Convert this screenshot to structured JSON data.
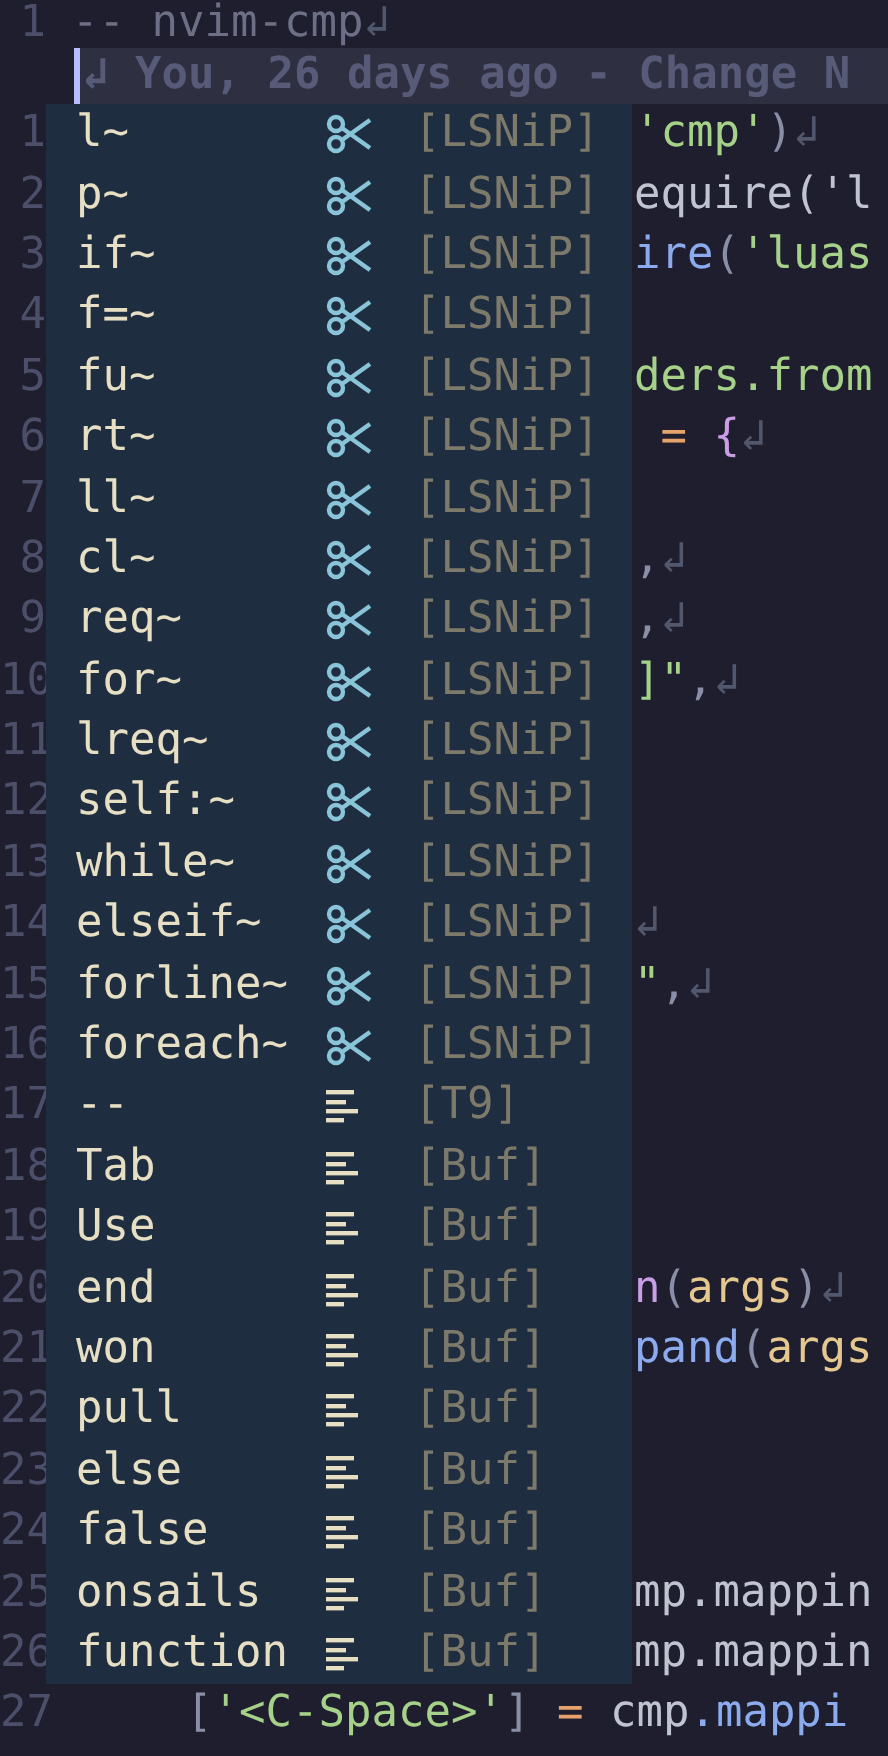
{
  "top_line": {
    "number": "1",
    "code": [
      {
        "text": "-- nvim-cmp",
        "kind": "comment"
      },
      {
        "text": "↲",
        "kind": "eol"
      }
    ]
  },
  "blame": {
    "text": "↲ You, 26 days ago - Change N"
  },
  "rows": [
    {
      "number": "1",
      "item": {
        "label": "l~",
        "kind": "snippet",
        "source": "[LSNiP]"
      },
      "code": [
        {
          "text": "'cmp'",
          "kind": "string"
        },
        {
          "text": ")",
          "kind": "punct"
        },
        {
          "text": "↲",
          "kind": "eol"
        }
      ]
    },
    {
      "number": "2",
      "item": {
        "label": "p~",
        "kind": "snippet",
        "source": "[LSNiP]"
      },
      "code": [
        {
          "text": "equire('l",
          "kind": "plain"
        }
      ]
    },
    {
      "number": "3",
      "item": {
        "label": "if~",
        "kind": "snippet",
        "source": "[LSNiP]"
      },
      "code": [
        {
          "text": "ire",
          "kind": "func"
        },
        {
          "text": "(",
          "kind": "punct"
        },
        {
          "text": "'luas",
          "kind": "string"
        }
      ]
    },
    {
      "number": "4",
      "item": {
        "label": "f=~",
        "kind": "snippet",
        "source": "[LSNiP]"
      },
      "code": []
    },
    {
      "number": "5",
      "item": {
        "label": "fu~",
        "kind": "snippet",
        "source": "[LSNiP]"
      },
      "code": [
        {
          "text": "ders.from",
          "kind": "string"
        }
      ]
    },
    {
      "number": "6",
      "item": {
        "label": "rt~",
        "kind": "snippet",
        "source": "[LSNiP]"
      },
      "code": [
        {
          "text": " = ",
          "kind": "op"
        },
        {
          "text": "{",
          "kind": "brace"
        },
        {
          "text": "↲",
          "kind": "eol"
        }
      ]
    },
    {
      "number": "7",
      "item": {
        "label": "ll~",
        "kind": "snippet",
        "source": "[LSNiP]"
      },
      "code": []
    },
    {
      "number": "8",
      "item": {
        "label": "cl~",
        "kind": "snippet",
        "source": "[LSNiP]"
      },
      "code": [
        {
          "text": ",",
          "kind": "punct"
        },
        {
          "text": "↲",
          "kind": "eol"
        }
      ]
    },
    {
      "number": "9",
      "item": {
        "label": "req~",
        "kind": "snippet",
        "source": "[LSNiP]"
      },
      "code": [
        {
          "text": ",",
          "kind": "punct"
        },
        {
          "text": "↲",
          "kind": "eol"
        }
      ]
    },
    {
      "number": "10",
      "item": {
        "label": "for~",
        "kind": "snippet",
        "source": "[LSNiP]"
      },
      "code": [
        {
          "text": "]\"",
          "kind": "string"
        },
        {
          "text": ",",
          "kind": "punct"
        },
        {
          "text": "↲",
          "kind": "eol"
        }
      ]
    },
    {
      "number": "11",
      "item": {
        "label": "lreq~",
        "kind": "snippet",
        "source": "[LSNiP]"
      },
      "code": []
    },
    {
      "number": "12",
      "item": {
        "label": "self:~",
        "kind": "snippet",
        "source": "[LSNiP]"
      },
      "code": []
    },
    {
      "number": "13",
      "item": {
        "label": "while~",
        "kind": "snippet",
        "source": "[LSNiP]"
      },
      "code": []
    },
    {
      "number": "14",
      "item": {
        "label": "elseif~",
        "kind": "snippet",
        "source": "[LSNiP]"
      },
      "code": [
        {
          "text": "↲",
          "kind": "eol"
        }
      ]
    },
    {
      "number": "15",
      "item": {
        "label": "forline~",
        "kind": "snippet",
        "source": "[LSNiP]"
      },
      "code": [
        {
          "text": "\"",
          "kind": "string"
        },
        {
          "text": ",",
          "kind": "punct"
        },
        {
          "text": "↲",
          "kind": "eol"
        }
      ]
    },
    {
      "number": "16",
      "item": {
        "label": "foreach~",
        "kind": "snippet",
        "source": "[LSNiP]"
      },
      "code": []
    },
    {
      "number": "17",
      "item": {
        "label": "--",
        "kind": "text",
        "source": "[T9]"
      },
      "code": []
    },
    {
      "number": "18",
      "item": {
        "label": "Tab",
        "kind": "text",
        "source": "[Buf]"
      },
      "code": []
    },
    {
      "number": "19",
      "item": {
        "label": "Use",
        "kind": "text",
        "source": "[Buf]"
      },
      "code": []
    },
    {
      "number": "20",
      "item": {
        "label": "end",
        "kind": "text",
        "source": "[Buf]"
      },
      "code": [
        {
          "text": "n",
          "kind": "keyword"
        },
        {
          "text": "(",
          "kind": "punct"
        },
        {
          "text": "args",
          "kind": "param"
        },
        {
          "text": ")",
          "kind": "punct"
        },
        {
          "text": "↲",
          "kind": "eol"
        }
      ]
    },
    {
      "number": "21",
      "item": {
        "label": "won",
        "kind": "text",
        "source": "[Buf]"
      },
      "code": [
        {
          "text": "pand",
          "kind": "func"
        },
        {
          "text": "(",
          "kind": "punct"
        },
        {
          "text": "args",
          "kind": "param"
        }
      ]
    },
    {
      "number": "22",
      "item": {
        "label": "pull",
        "kind": "text",
        "source": "[Buf]"
      },
      "code": []
    },
    {
      "number": "23",
      "item": {
        "label": "else",
        "kind": "text",
        "source": "[Buf]"
      },
      "code": []
    },
    {
      "number": "24",
      "item": {
        "label": "false",
        "kind": "text",
        "source": "[Buf]"
      },
      "code": []
    },
    {
      "number": "25",
      "item": {
        "label": "onsails",
        "kind": "text",
        "source": "[Buf]"
      },
      "code": [
        {
          "text": "mp.mappin",
          "kind": "plain"
        }
      ]
    },
    {
      "number": "26",
      "item": {
        "label": "function",
        "kind": "text",
        "source": "[Buf]"
      },
      "code": [
        {
          "text": "mp.mappin",
          "kind": "plain"
        }
      ]
    }
  ],
  "bottom_line": {
    "number": "27",
    "code": [
      {
        "text": "[",
        "kind": "punct"
      },
      {
        "text": "'<C-Space>'",
        "kind": "string"
      },
      {
        "text": "]",
        "kind": "punct"
      },
      {
        "text": " = ",
        "kind": "op"
      },
      {
        "text": "cmp",
        "kind": "plain"
      },
      {
        "text": ".mappi",
        "kind": "func"
      }
    ]
  }
}
